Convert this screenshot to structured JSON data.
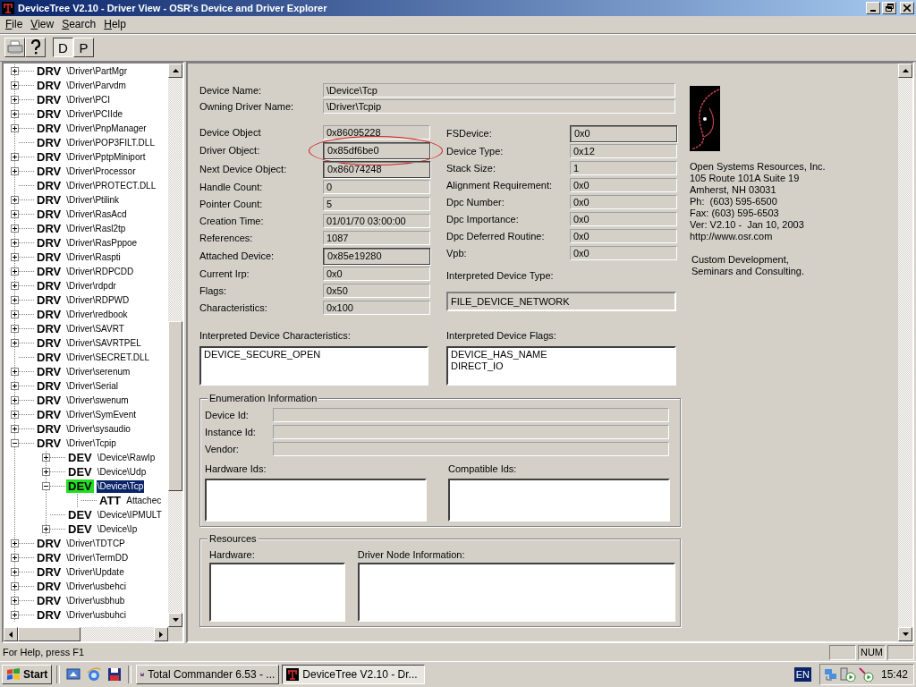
{
  "window": {
    "title": "DeviceTree V2.10 - Driver View - OSR's Device and Driver Explorer"
  },
  "menu": [
    "File",
    "View",
    "Search",
    "Help"
  ],
  "toolbar": [
    {
      "kind": "print",
      "selected": false
    },
    {
      "kind": "help",
      "selected": false
    },
    {
      "kind": "text",
      "label": "D",
      "selected": true
    },
    {
      "kind": "text",
      "label": "P",
      "selected": false
    }
  ],
  "tree": [
    {
      "tag": "DRV",
      "label": "\\Driver\\PartMgr",
      "leaf": false,
      "expanded": false,
      "selected": false
    },
    {
      "tag": "DRV",
      "label": "\\Driver\\Parvdm",
      "leaf": false,
      "expanded": false,
      "selected": false
    },
    {
      "tag": "DRV",
      "label": "\\Driver\\PCI",
      "leaf": false,
      "expanded": false,
      "selected": false
    },
    {
      "tag": "DRV",
      "label": "\\Driver\\PCIIde",
      "leaf": false,
      "expanded": false,
      "selected": false
    },
    {
      "tag": "DRV",
      "label": "\\Driver\\PnpManager",
      "leaf": false,
      "expanded": false,
      "selected": false
    },
    {
      "tag": "DRV",
      "label": "\\Driver\\POP3FILT.DLL",
      "leaf": true,
      "selected": false
    },
    {
      "tag": "DRV",
      "label": "\\Driver\\PptpMiniport",
      "leaf": false,
      "expanded": false,
      "selected": false
    },
    {
      "tag": "DRV",
      "label": "\\Driver\\Processor",
      "leaf": false,
      "expanded": false,
      "selected": false
    },
    {
      "tag": "DRV",
      "label": "\\Driver\\PROTECT.DLL",
      "leaf": true,
      "selected": false
    },
    {
      "tag": "DRV",
      "label": "\\Driver\\Ptilink",
      "leaf": false,
      "expanded": false,
      "selected": false
    },
    {
      "tag": "DRV",
      "label": "\\Driver\\RasAcd",
      "leaf": false,
      "expanded": false,
      "selected": false
    },
    {
      "tag": "DRV",
      "label": "\\Driver\\Rasl2tp",
      "leaf": false,
      "expanded": false,
      "selected": false
    },
    {
      "tag": "DRV",
      "label": "\\Driver\\RasPppoe",
      "leaf": false,
      "expanded": false,
      "selected": false
    },
    {
      "tag": "DRV",
      "label": "\\Driver\\Raspti",
      "leaf": false,
      "expanded": false,
      "selected": false
    },
    {
      "tag": "DRV",
      "label": "\\Driver\\RDPCDD",
      "leaf": false,
      "expanded": false,
      "selected": false
    },
    {
      "tag": "DRV",
      "label": "\\Driver\\rdpdr",
      "leaf": false,
      "expanded": false,
      "selected": false
    },
    {
      "tag": "DRV",
      "label": "\\Driver\\RDPWD",
      "leaf": false,
      "expanded": false,
      "selected": false
    },
    {
      "tag": "DRV",
      "label": "\\Driver\\redbook",
      "leaf": false,
      "expanded": false,
      "selected": false
    },
    {
      "tag": "DRV",
      "label": "\\Driver\\SAVRT",
      "leaf": false,
      "expanded": false,
      "selected": false
    },
    {
      "tag": "DRV",
      "label": "\\Driver\\SAVRTPEL",
      "leaf": false,
      "expanded": false,
      "selected": false
    },
    {
      "tag": "DRV",
      "label": "\\Driver\\SECRET.DLL",
      "leaf": true,
      "selected": false
    },
    {
      "tag": "DRV",
      "label": "\\Driver\\serenum",
      "leaf": false,
      "expanded": false,
      "selected": false
    },
    {
      "tag": "DRV",
      "label": "\\Driver\\Serial",
      "leaf": false,
      "expanded": false,
      "selected": false
    },
    {
      "tag": "DRV",
      "label": "\\Driver\\swenum",
      "leaf": false,
      "expanded": false,
      "selected": false
    },
    {
      "tag": "DRV",
      "label": "\\Driver\\SymEvent",
      "leaf": false,
      "expanded": false,
      "selected": false
    },
    {
      "tag": "DRV",
      "label": "\\Driver\\sysaudio",
      "leaf": false,
      "expanded": false,
      "selected": false
    },
    {
      "tag": "DRV",
      "label": "\\Driver\\Tcpip",
      "leaf": false,
      "expanded": true,
      "selected": false,
      "children": [
        {
          "tag": "DEV",
          "label": "\\Device\\RawIp",
          "leaf": false,
          "expanded": false,
          "selected": false
        },
        {
          "tag": "DEV",
          "label": "\\Device\\Udp",
          "leaf": false,
          "expanded": false,
          "selected": false
        },
        {
          "tag": "DEV",
          "label": "\\Device\\Tcp",
          "leaf": false,
          "expanded": true,
          "selected": true,
          "children": [
            {
              "tag": "ATT",
              "label": "Attachec",
              "leaf": true,
              "selected": false
            }
          ]
        },
        {
          "tag": "DEV",
          "label": "\\Device\\IPMULT",
          "leaf": true,
          "selected": false
        },
        {
          "tag": "DEV",
          "label": "\\Device\\Ip",
          "leaf": false,
          "expanded": false,
          "selected": false
        }
      ]
    },
    {
      "tag": "DRV",
      "label": "\\Driver\\TDTCP",
      "leaf": false,
      "expanded": false,
      "selected": false
    },
    {
      "tag": "DRV",
      "label": "\\Driver\\TermDD",
      "leaf": false,
      "expanded": false,
      "selected": false
    },
    {
      "tag": "DRV",
      "label": "\\Driver\\Update",
      "leaf": false,
      "expanded": false,
      "selected": false
    },
    {
      "tag": "DRV",
      "label": "\\Driver\\usbehci",
      "leaf": false,
      "expanded": false,
      "selected": false
    },
    {
      "tag": "DRV",
      "label": "\\Driver\\usbhub",
      "leaf": false,
      "expanded": false,
      "selected": false
    },
    {
      "tag": "DRV",
      "label": "\\Driver\\usbuhci",
      "leaf": false,
      "expanded": false,
      "selected": false
    }
  ],
  "details": {
    "top_fields": [
      {
        "label": "Device Name:",
        "value": "\\Device\\Tcp"
      },
      {
        "label": "Owning Driver Name:",
        "value": "\\Driver\\Tcpip"
      }
    ],
    "left_fields": [
      {
        "label": "Device Object",
        "value": "0x86095228",
        "kind": "plain",
        "circled": false
      },
      {
        "label": "Driver Object:",
        "value": "0x85df6be0",
        "kind": "link",
        "circled": true
      },
      {
        "label": "Next Device Object:",
        "value": "0x86074248",
        "kind": "link",
        "circled": false
      },
      {
        "label": "Handle Count:",
        "value": "0",
        "kind": "plain",
        "circled": false
      },
      {
        "label": "Pointer Count:",
        "value": "5",
        "kind": "plain",
        "circled": false
      },
      {
        "label": "Creation Time:",
        "value": "01/01/70 03:00:00",
        "kind": "plain",
        "circled": false
      },
      {
        "label": "References:",
        "value": "1087",
        "kind": "plain",
        "circled": false
      },
      {
        "label": "Attached Device:",
        "value": "0x85e19280",
        "kind": "link",
        "circled": false
      },
      {
        "label": "Current Irp:",
        "value": "0x0",
        "kind": "plain",
        "circled": false
      },
      {
        "label": "Flags:",
        "value": "0x50",
        "kind": "plain",
        "circled": false
      },
      {
        "label": "Characteristics:",
        "value": "0x100",
        "kind": "plain",
        "circled": false
      }
    ],
    "right_fields": [
      {
        "label": "FSDevice:",
        "value": "0x0",
        "kind": "link",
        "circled": false
      },
      {
        "label": "Device Type:",
        "value": "0x12",
        "kind": "plain",
        "circled": false
      },
      {
        "label": "Stack Size:",
        "value": "1",
        "kind": "plain",
        "circled": false
      },
      {
        "label": "Alignment Requirement:",
        "value": "0x0",
        "kind": "plain",
        "circled": false
      },
      {
        "label": "Dpc Number:",
        "value": "0x0",
        "kind": "plain",
        "circled": false
      },
      {
        "label": "Dpc Importance:",
        "value": "0x0",
        "kind": "plain",
        "circled": false
      },
      {
        "label": "Dpc Deferred Routine:",
        "value": "0x0",
        "kind": "plain",
        "circled": false
      },
      {
        "label": "Vpb:",
        "value": "0x0",
        "kind": "plain",
        "circled": false
      }
    ],
    "device_type": {
      "label": "Interpreted Device Type:",
      "value": "FILE_DEVICE_NETWORK"
    },
    "characteristics": {
      "label": "Interpreted Device Characteristics:",
      "lines": [
        "DEVICE_SECURE_OPEN"
      ]
    },
    "flags": {
      "label": "Interpreted Device Flags:",
      "lines": [
        "DEVICE_HAS_NAME",
        "DIRECT_IO"
      ]
    },
    "enumeration": {
      "title": "Enumeration Information",
      "fields": [
        "Device Id:",
        "Instance Id:",
        "Vendor:"
      ],
      "hardware_ids": "Hardware Ids:",
      "compatible_ids": "Compatible Ids:"
    },
    "resources": {
      "title": "Resources",
      "hardware": "Hardware:",
      "driver_node": "Driver Node Information:"
    }
  },
  "about": {
    "address": [
      "Open Systems Resources, Inc.",
      "105 Route 101A Suite 19",
      "Amherst, NH 03031",
      "Ph:  (603) 595-6500",
      "Fax: (603) 595-6503",
      "Ver: V2.10 -  Jan 10, 2003",
      "http://www.osr.com"
    ],
    "tagline": [
      "Custom Development,",
      "Seminars and Consulting."
    ]
  },
  "status_bar": {
    "text": "For Help, press F1",
    "indicator": "NUM"
  },
  "taskbar": {
    "start": "Start",
    "tasks": [
      {
        "label": "Total Commander 6.53 - ...",
        "selected": false
      },
      {
        "label": "DeviceTree V2.10 - Dr...",
        "selected": true
      }
    ],
    "language": "EN",
    "clock": "15:42"
  }
}
